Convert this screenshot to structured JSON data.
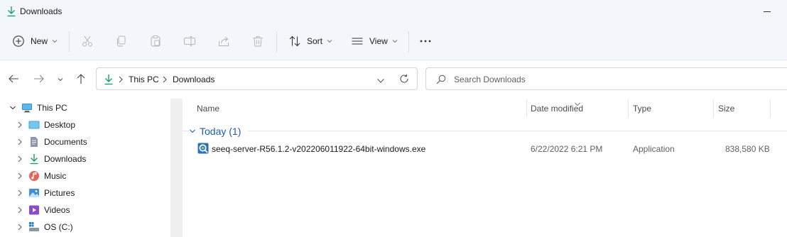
{
  "window": {
    "title": "Downloads"
  },
  "toolbar": {
    "new_label": "New",
    "sort_label": "Sort",
    "view_label": "View"
  },
  "address": {
    "crumbs": [
      "This PC",
      "Downloads"
    ]
  },
  "search": {
    "placeholder": "Search Downloads"
  },
  "nav": {
    "items": [
      {
        "label": "This PC",
        "icon": "pc-icon"
      },
      {
        "label": "Desktop",
        "icon": "desktop-folder-icon"
      },
      {
        "label": "Documents",
        "icon": "documents-icon"
      },
      {
        "label": "Downloads",
        "icon": "download-icon"
      },
      {
        "label": "Music",
        "icon": "music-icon"
      },
      {
        "label": "Pictures",
        "icon": "pictures-icon"
      },
      {
        "label": "Videos",
        "icon": "videos-icon"
      },
      {
        "label": "OS (C:)",
        "icon": "drive-icon"
      }
    ]
  },
  "list": {
    "columns": [
      "Name",
      "Date modified",
      "Type",
      "Size"
    ],
    "group": "Today (1)",
    "rows": [
      {
        "name": "seeq-server-R56.1.2-v202206011922-64bit-windows.exe",
        "date": "6/22/2022 6:21 PM",
        "type": "Application",
        "size": "838,580 KB"
      }
    ]
  },
  "colors": {
    "accent": "#1a5fa8",
    "toolbar_bg": "#f3f6fb",
    "download_green": "#1a9e6c"
  }
}
